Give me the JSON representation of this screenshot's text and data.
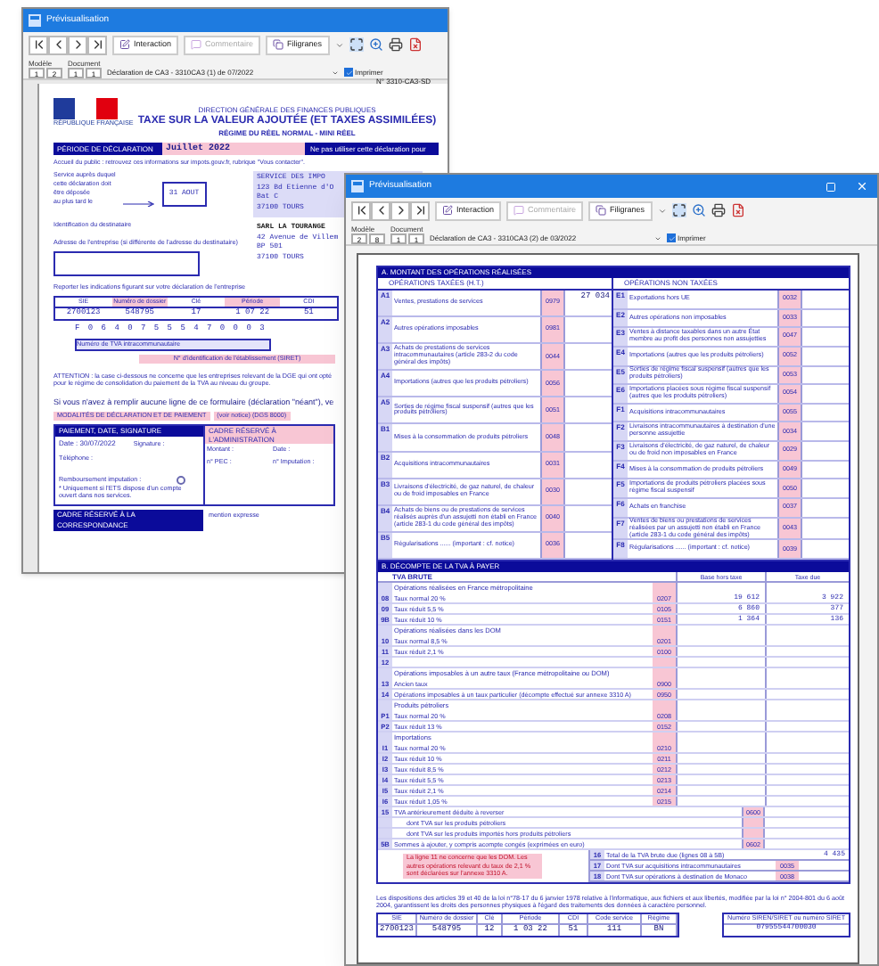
{
  "back_window": {
    "title": "Prévisualisation",
    "buttons": [
      {
        "label": "Interaction",
        "disabled": false
      },
      {
        "label": "Commentaire",
        "disabled": true
      },
      {
        "label": "Filigranes",
        "disabled": false
      }
    ],
    "model_label": "Modèle",
    "document_label": "Document",
    "counters": [
      "1",
      "2",
      "1",
      "1"
    ],
    "document_select": "Déclaration de CA3 - 3310CA3 (1) de 07/2022",
    "print": {
      "label": "Imprimer",
      "checked": true
    },
    "form": {
      "form_number": "N° 3310-CA3-SD",
      "header": [
        "DIRECTION GÉNÉRALE DES FINANCES PUBLIQUES",
        "TAXE SUR LA VALEUR AJOUTÉE (ET TAXES ASSIMILÉES)",
        "RÉGIME DU RÉEL NORMAL - MINI RÉEL"
      ],
      "logo_caption": "RÉPUBLIQUE FRANÇAISE",
      "period_label": "PÉRIODE DE DÉCLARATION",
      "period": "Juillet 2022",
      "period_warning": "Ne pas utiliser cette déclaration pour",
      "public_notice": "Accueil du public : retrouvez ces informations sur impots.gouv.fr, rubrique \"Vous contacter\".",
      "service_labels": [
        "Service auprès duquel",
        "cette déclaration doit",
        "être déposée",
        "au plus tard le"
      ],
      "deadline": "31 AOUT",
      "recipient_label": "Identification du destinataire",
      "address_change_label": "Adresse de l'entreprise (si différente de l'adresse du destinataire)",
      "service_address": [
        "SERVICE DES IMPO",
        "123 Bd Etienne d'O",
        "Bat C",
        "37100 TOURS"
      ],
      "company_address": [
        "SARL LA TOURANGE",
        "42 Avenue de Villem",
        "BP 501",
        "37100 TOURS"
      ],
      "instructions": "Reporter les indications figurant sur votre déclaration de l'entreprise",
      "id_table": {
        "columns": [
          "SIE",
          "Numéro de dossier",
          "Clé",
          "Période",
          "CDI"
        ],
        "values": [
          "2700123",
          "548795",
          "17",
          "1 07 22",
          "51"
        ]
      },
      "siret_digits": "F 0 6 4 0 7 5 5 5 4 7 0 0 0 3",
      "vat_number_label": "Numéro de TVA intracommunautaire",
      "siret_label": "N° d'identification de l'établissement (SIRET)",
      "attention": "ATTENTION : la case ci-dessous ne concerne que les entreprises relevant de la DGE qui ont opté pour le régime de consolidation du paiement de la TVA au niveau du groupe.",
      "nil_notice": "Si vous n'avez à remplir aucune ligne de ce formulaire (déclaration \"néant\"), ve",
      "modalities": "MODALITÉS DE DÉCLARATION ET DE PAIEMENT",
      "modalities_note": "(voir notice) (DGS 8000)",
      "payment_header": "PAIEMENT, DATE, SIGNATURE",
      "admin_header": "CADRE RÉSERVÉ À L'ADMINISTRATION",
      "date": "Date : 30/07/2022",
      "signature_label": "Signature :",
      "phone_label": "Téléphone :",
      "refund": {
        "label": "Remboursement imputation :",
        "checked": false
      },
      "refund_note": "* Uniquement si l'ETS dispose d'un compte ouvert dans nos services.",
      "admin_fields": [
        "Montant :",
        "Date :",
        "n° PEC :",
        "n° Imputation :"
      ],
      "correspondence_header": "CADRE RÉSERVÉ À LA CORRESPONDANCE",
      "correspondence_note": "mention expresse"
    }
  },
  "front_window": {
    "title": "Prévisualisation",
    "buttons": [
      {
        "label": "Interaction",
        "disabled": false
      },
      {
        "label": "Commentaire",
        "disabled": true
      },
      {
        "label": "Filigranes",
        "disabled": false
      }
    ],
    "model_label": "Modèle",
    "document_label": "Document",
    "counters": [
      "2",
      "8",
      "1",
      "1"
    ],
    "document_select": "Déclaration de CA3 - 3310CA3 (2) de 03/2022",
    "print": {
      "label": "Imprimer",
      "checked": true
    },
    "section_a": {
      "title": "A. MONTANT DES OPÉRATIONS RÉALISÉES",
      "left_title": "OPÉRATIONS TAXÉES (H.T.)",
      "right_title": "OPÉRATIONS NON TAXÉES",
      "left": [
        {
          "num": "A1",
          "label": "Ventes, prestations de services",
          "code": "0979",
          "value": "27 034"
        },
        {
          "num": "A2",
          "label": "Autres opérations imposables",
          "code": "0981"
        },
        {
          "num": "A3",
          "label": "Achats de prestations de services intracommunautaires (article 283-2 du code général des impôts)",
          "code": "0044"
        },
        {
          "num": "A4",
          "label": "Importations (autres que les produits pétroliers)",
          "code": "0056"
        },
        {
          "num": "A5",
          "label": "Sorties de régime fiscal suspensif (autres que les produits pétroliers)",
          "code": "0051"
        },
        {
          "num": "B1",
          "label": "Mises à la consommation de produits pétroliers",
          "code": "0048"
        },
        {
          "num": "B2",
          "label": "Acquisitions intracommunautaires",
          "code": "0031"
        },
        {
          "num": "B3",
          "label": "Livraisons d'électricité, de gaz naturel, de chaleur ou de froid imposables en France",
          "code": "0030"
        },
        {
          "num": "B4",
          "label": "Achats de biens ou de prestations de services réalisés auprès d'un assujetti non établi en France (article 283-1 du code général des impôts)",
          "code": "0040"
        },
        {
          "num": "B5",
          "label": "Régularisations ...... (important : cf. notice)",
          "code": "0036"
        }
      ],
      "right": [
        {
          "num": "E1",
          "label": "Exportations hors UE",
          "code": "0032"
        },
        {
          "num": "E2",
          "label": "Autres opérations non imposables",
          "code": "0033"
        },
        {
          "num": "E3",
          "label": "Ventes à distance taxables dans un autre État membre au profit des personnes non assujetties",
          "code": "0047"
        },
        {
          "num": "E4",
          "label": "Importations (autres que les produits pétroliers)",
          "code": "0052"
        },
        {
          "num": "E5",
          "label": "Sorties de régime fiscal suspensif (autres que les produits pétroliers)",
          "code": "0053"
        },
        {
          "num": "E6",
          "label": "Importations placées sous régime fiscal suspensif (autres que les produits pétroliers)",
          "code": "0054"
        },
        {
          "num": "F1",
          "label": "Acquisitions intracommunautaires",
          "code": "0055"
        },
        {
          "num": "F2",
          "label": "Livraisons intracommunautaires à destination d'une personne assujettie",
          "code": "0034"
        },
        {
          "num": "F3",
          "label": "Livraisons d'électricité, de gaz naturel, de chaleur ou de froid non imposables en France",
          "code": "0029"
        },
        {
          "num": "F4",
          "label": "Mises à la consommation de produits pétroliers",
          "code": "0049"
        },
        {
          "num": "F5",
          "label": "Importations de produits pétroliers placées sous régime fiscal suspensif",
          "code": "0050"
        },
        {
          "num": "F6",
          "label": "Achats en franchise",
          "code": "0037"
        },
        {
          "num": "F7",
          "label": "Ventes de biens ou prestations de services réalisées par un assujetti non établi en France (article 283-1 du code général des impôts)",
          "code": "0043"
        },
        {
          "num": "F8",
          "label": "Régularisations ...... (important : cf. notice)",
          "code": "0039"
        }
      ]
    },
    "section_b": {
      "title": "B. DÉCOMPTE DE LA TVA À PAYER",
      "subtitle": "TVA BRUTE",
      "base_header": "Base hors taxe",
      "tax_header": "Taxe due",
      "rows": [
        {
          "kind": "group",
          "label": "Opérations réalisées en France métropolitaine"
        },
        {
          "kind": "line",
          "num": "08",
          "label": "Taux normal 20 %",
          "code": "0207",
          "base": "19 612",
          "tax": "3 922"
        },
        {
          "kind": "line",
          "num": "09",
          "label": "Taux réduit 5,5 %",
          "code": "0105",
          "base": "6 860",
          "tax": "377"
        },
        {
          "kind": "line",
          "num": "9B",
          "label": "Taux réduit 10 %",
          "code": "0151",
          "base": "1 364",
          "tax": "136"
        },
        {
          "kind": "group",
          "label": "Opérations réalisées dans les DOM"
        },
        {
          "kind": "line",
          "num": "10",
          "label": "Taux normal 8,5 %",
          "code": "0201"
        },
        {
          "kind": "line",
          "num": "11",
          "label": "Taux réduit 2,1 %",
          "code": "0100"
        },
        {
          "kind": "line",
          "num": "12"
        },
        {
          "kind": "group",
          "label": "Opérations imposables à un autre taux (France métropolitaine ou DOM)"
        },
        {
          "kind": "line",
          "num": "13",
          "label": "Ancien taux",
          "code": "0900"
        },
        {
          "kind": "line",
          "num": "14",
          "label": "Opérations imposables à un taux particulier (décompte effectué sur annexe 3310 A)",
          "code": "0950"
        },
        {
          "kind": "group",
          "label": "Produits pétroliers"
        },
        {
          "kind": "line",
          "num": "P1",
          "label": "Taux normal 20 %",
          "code": "0208"
        },
        {
          "kind": "line",
          "num": "P2",
          "label": "Taux réduit 13 %",
          "code": "0152"
        },
        {
          "kind": "group",
          "label": "Importations"
        },
        {
          "kind": "line",
          "num": "I1",
          "label": "Taux normal 20 %",
          "code": "0210"
        },
        {
          "kind": "line",
          "num": "I2",
          "label": "Taux réduit 10 %",
          "code": "0211"
        },
        {
          "kind": "line",
          "num": "I3",
          "label": "Taux réduit 8,5 %",
          "code": "0212"
        },
        {
          "kind": "line",
          "num": "I4",
          "label": "Taux réduit 5,5 %",
          "code": "0213"
        },
        {
          "kind": "line",
          "num": "I5",
          "label": "Taux réduit 2,1 %",
          "code": "0214"
        },
        {
          "kind": "line",
          "num": "I6",
          "label": "Taux réduit 1,05 %",
          "code": "0215"
        },
        {
          "kind": "tax_line",
          "num": "15",
          "label": "TVA antérieurement déduite à reverser",
          "code": "0600"
        },
        {
          "kind": "tax_line",
          "label": "dont TVA sur les produits pétroliers"
        },
        {
          "kind": "tax_line",
          "label": "dont TVA sur les produits importés hors produits pétroliers"
        },
        {
          "kind": "tax_line",
          "num": "5B",
          "label": "Sommes à ajouter, y compris acompte congés (exprimées en euro)",
          "code": "0602"
        }
      ],
      "note": "La ligne 11 ne concerne que les DOM. Les autres opérations relevant du taux de 2,1 % sont déclarées sur l'annexe 3310 A.",
      "totals": [
        {
          "num": "16",
          "label": "Total de la TVA brute due (lignes 08 à 5B)",
          "value": "4 435"
        },
        {
          "num": "17",
          "label": "Dont TVA sur acquisitions intracommunautaires",
          "code": "0035"
        },
        {
          "num": "18",
          "label": "Dont TVA sur opérations à destination de Monaco",
          "code": "0038"
        }
      ]
    },
    "footer_text": "Les dispositions des articles 39 et 40 de la loi n°78-17 du 6 janvier 1978 relative à l'informatique, aux fichiers et aux libertés, modifiée par la loi n° 2004-801 du 6 août 2004, garantissent les droits des personnes physiques à l'égard des traitements des données à caractère personnel.",
    "footer_table": {
      "columns": [
        "SIE",
        "Numéro de dossier",
        "Clé",
        "Période",
        "CDI",
        "Code service",
        "Régime"
      ],
      "values": [
        "2700123",
        "548795",
        "12",
        "1 03 22",
        "51",
        "111",
        "BN"
      ]
    },
    "siret": {
      "label": "Numéro SIREN/SIRET ou numéro SIRET",
      "value": "07955544700030"
    }
  }
}
